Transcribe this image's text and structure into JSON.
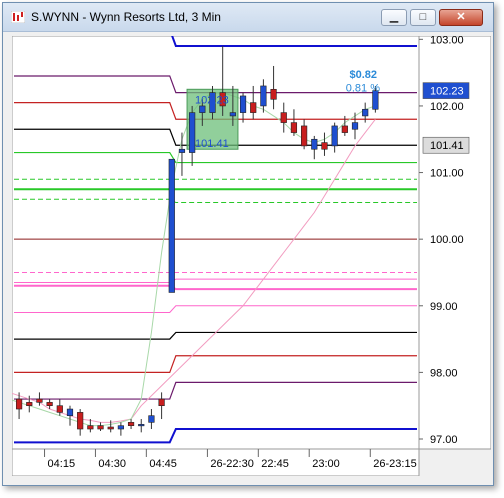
{
  "window": {
    "title": "S.WYNN - Wynn Resorts Ltd, 3 Min",
    "buttons": {
      "minimize": "▁",
      "maximize": "□",
      "close": "✕"
    }
  },
  "colors": {
    "up": "#1f4fd0",
    "down": "#c81e1e",
    "chart_bg": "#ffffff",
    "axis_bg": "#ffffff"
  },
  "chart_data": {
    "type": "candlestick",
    "symbol": "S.WYNN",
    "interval": "3 Min",
    "ylim": [
      96.85,
      103.05
    ],
    "y_ticks": [
      "103.00",
      "102.00",
      "101.00",
      "100.00",
      "99.00",
      "98.00",
      "97.00"
    ],
    "y_tick_values": [
      103.0,
      102.0,
      101.0,
      100.0,
      99.0,
      98.0,
      97.0
    ],
    "x_ticks": [
      "04:15",
      "04:30",
      "04:45",
      "26-22:30",
      "22:45",
      "23:00",
      "26-23:15"
    ],
    "x_tick_positions": [
      3,
      8,
      13,
      19,
      24,
      29,
      35
    ],
    "x_count": 39,
    "candles": [
      {
        "o": 97.6,
        "h": 97.7,
        "l": 97.3,
        "c": 97.45
      },
      {
        "o": 97.55,
        "h": 97.65,
        "l": 97.4,
        "c": 97.5
      },
      {
        "o": 97.6,
        "h": 97.7,
        "l": 97.5,
        "c": 97.55
      },
      {
        "o": 97.55,
        "h": 97.6,
        "l": 97.45,
        "c": 97.5
      },
      {
        "o": 97.5,
        "h": 97.6,
        "l": 97.35,
        "c": 97.4
      },
      {
        "o": 97.35,
        "h": 97.5,
        "l": 97.2,
        "c": 97.45
      },
      {
        "o": 97.4,
        "h": 97.45,
        "l": 97.05,
        "c": 97.15
      },
      {
        "o": 97.2,
        "h": 97.3,
        "l": 97.1,
        "c": 97.15
      },
      {
        "o": 97.2,
        "h": 97.25,
        "l": 97.12,
        "c": 97.15
      },
      {
        "o": 97.18,
        "h": 97.28,
        "l": 97.1,
        "c": 97.15
      },
      {
        "o": 97.15,
        "h": 97.25,
        "l": 97.05,
        "c": 97.2
      },
      {
        "o": 97.25,
        "h": 97.3,
        "l": 97.15,
        "c": 97.2
      },
      {
        "o": 97.2,
        "h": 97.3,
        "l": 97.1,
        "c": 97.22
      },
      {
        "o": 97.25,
        "h": 97.45,
        "l": 97.15,
        "c": 97.35
      },
      {
        "o": 97.6,
        "h": 97.7,
        "l": 97.3,
        "c": 97.5
      },
      {
        "o": 99.2,
        "h": 101.2,
        "l": 99.85,
        "c": 101.2
      },
      {
        "o": 101.3,
        "h": 101.6,
        "l": 100.95,
        "c": 101.35
      },
      {
        "o": 101.3,
        "h": 102.0,
        "l": 101.1,
        "c": 101.9
      },
      {
        "o": 101.9,
        "h": 102.1,
        "l": 101.7,
        "c": 102.0
      },
      {
        "o": 101.9,
        "h": 102.3,
        "l": 101.8,
        "c": 102.2
      },
      {
        "o": 102.2,
        "h": 102.9,
        "l": 101.85,
        "c": 102.0
      },
      {
        "o": 101.85,
        "h": 102.3,
        "l": 101.7,
        "c": 101.9
      },
      {
        "o": 101.9,
        "h": 102.2,
        "l": 101.75,
        "c": 102.15
      },
      {
        "o": 102.05,
        "h": 102.3,
        "l": 101.8,
        "c": 101.9
      },
      {
        "o": 102.0,
        "h": 102.4,
        "l": 101.9,
        "c": 102.3
      },
      {
        "o": 102.25,
        "h": 102.6,
        "l": 101.95,
        "c": 102.1
      },
      {
        "o": 101.9,
        "h": 102.05,
        "l": 101.6,
        "c": 101.75
      },
      {
        "o": 101.75,
        "h": 101.95,
        "l": 101.55,
        "c": 101.6
      },
      {
        "o": 101.7,
        "h": 101.8,
        "l": 101.35,
        "c": 101.4
      },
      {
        "o": 101.35,
        "h": 101.55,
        "l": 101.2,
        "c": 101.5
      },
      {
        "o": 101.45,
        "h": 101.6,
        "l": 101.25,
        "c": 101.35
      },
      {
        "o": 101.4,
        "h": 101.75,
        "l": 101.3,
        "c": 101.7
      },
      {
        "o": 101.7,
        "h": 101.85,
        "l": 101.55,
        "c": 101.6
      },
      {
        "o": 101.65,
        "h": 101.9,
        "l": 101.5,
        "c": 101.75
      },
      {
        "o": 101.85,
        "h": 102.05,
        "l": 101.75,
        "c": 101.95
      },
      {
        "o": 101.95,
        "h": 102.3,
        "l": 101.9,
        "c": 102.23
      }
    ],
    "level_lines": [
      {
        "y_pre": 103.15,
        "y_post": 102.9,
        "color": "#1010d0",
        "dash": false,
        "width": 2
      },
      {
        "y_pre": 102.45,
        "y_post": 102.2,
        "color": "#6b1a6b",
        "dash": false,
        "width": 1.2
      },
      {
        "y_pre": 102.05,
        "y_post": 101.8,
        "color": "#c42222",
        "dash": false,
        "width": 1.2
      },
      {
        "y_pre": 101.65,
        "y_post": 101.41,
        "color": "#000000",
        "dash": false,
        "width": 1.2
      },
      {
        "y_pre": 101.3,
        "y_post": 101.15,
        "color": "#28c828",
        "dash": false,
        "width": 1.2
      },
      {
        "y_pre": 100.9,
        "y_post": 100.9,
        "color": "#28c828",
        "dash": true,
        "width": 1
      },
      {
        "y_pre": 100.75,
        "y_post": 100.75,
        "color": "#28c828",
        "dash": false,
        "width": 2
      },
      {
        "y_pre": 100.6,
        "y_post": 100.55,
        "color": "#28c828",
        "dash": true,
        "width": 1
      },
      {
        "y_pre": 100.0,
        "y_post": 100.0,
        "color": "#8b1a1a",
        "dash": false,
        "width": 1
      },
      {
        "y_pre": 99.5,
        "y_post": 99.5,
        "color": "#ff66cc",
        "dash": true,
        "width": 1
      },
      {
        "y_pre": 99.35,
        "y_post": 99.4,
        "color": "#ff66cc",
        "dash": false,
        "width": 1
      },
      {
        "y_pre": 99.3,
        "y_post": 99.25,
        "color": "#ff66cc",
        "dash": false,
        "width": 2
      },
      {
        "y_pre": 98.9,
        "y_post": 99.0,
        "color": "#ff66cc",
        "dash": false,
        "width": 1
      },
      {
        "y_pre": 98.5,
        "y_post": 98.6,
        "color": "#000000",
        "dash": false,
        "width": 1.2
      },
      {
        "y_pre": 98.0,
        "y_post": 98.25,
        "color": "#c42222",
        "dash": false,
        "width": 1.2
      },
      {
        "y_pre": 97.6,
        "y_post": 97.85,
        "color": "#6b1a6b",
        "dash": false,
        "width": 1.2
      },
      {
        "y_pre": 96.95,
        "y_post": 97.15,
        "color": "#1010d0",
        "dash": false,
        "width": 2
      }
    ],
    "level_split_index": 15,
    "moving_average_pink": [
      97.8,
      97.75,
      97.7,
      97.65,
      97.6,
      97.55,
      97.45,
      97.4,
      97.35,
      97.3,
      97.28,
      97.25,
      97.25,
      97.27,
      97.3,
      97.5,
      97.65,
      97.8,
      97.95,
      98.1,
      98.25,
      98.4,
      98.55,
      98.7,
      98.85,
      99.0,
      99.2,
      99.4,
      99.6,
      99.8,
      100.0,
      100.2,
      100.4,
      100.65,
      100.9,
      101.15,
      101.4,
      101.6,
      101.8
    ],
    "moving_average_green": [
      97.7,
      97.65,
      97.6,
      97.55,
      97.5,
      97.45,
      97.4,
      97.35,
      97.3,
      97.25,
      97.2,
      97.2,
      97.22,
      97.25,
      97.3,
      97.6,
      98.6,
      99.8,
      100.8,
      101.5,
      101.9,
      102.1,
      102.2,
      102.2,
      102.15,
      102.1,
      102.0,
      101.95,
      101.85,
      101.75,
      101.6,
      101.5,
      101.45,
      101.5,
      101.6,
      101.75,
      101.85,
      101.95,
      102.0
    ],
    "highlight_box": {
      "x_start": 17,
      "x_end": 22,
      "y_top": 102.25,
      "y_bottom": 101.35
    },
    "annotations": {
      "box_top_label": "102.23",
      "box_bottom_label": "101.41",
      "change_value": "$0.82",
      "change_percent": "0.81 %"
    },
    "price_labels": [
      {
        "value": 102.23,
        "text": "102.23",
        "bg": "#1f4fd0",
        "fg": "#ffffff"
      },
      {
        "value": 101.41,
        "text": "101.41",
        "bg": "#dcdcdc",
        "fg": "#000000"
      }
    ]
  }
}
